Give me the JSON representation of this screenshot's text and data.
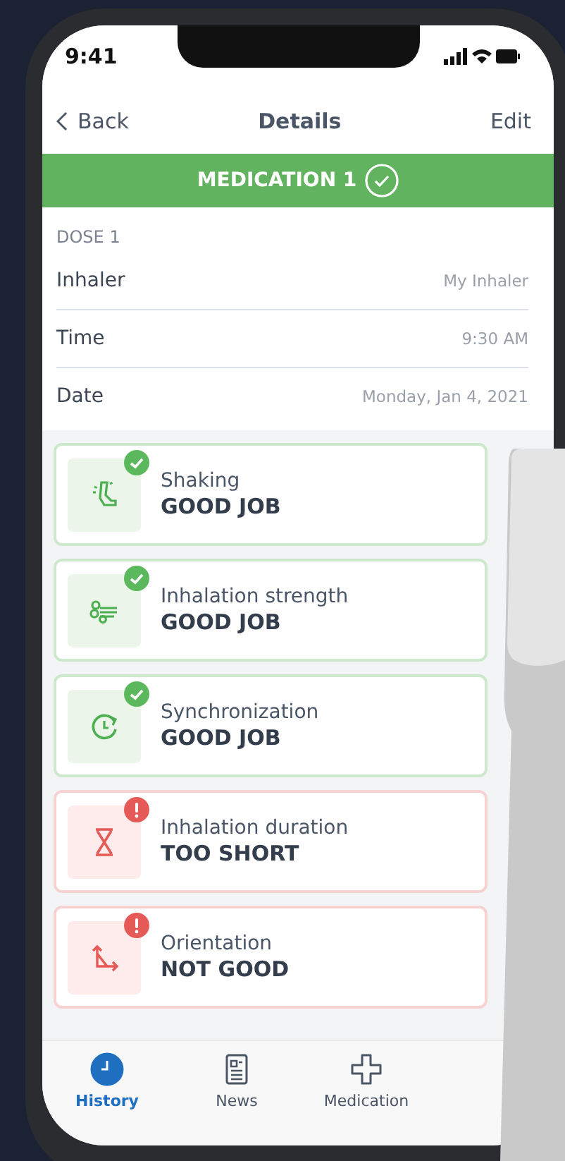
{
  "status_bar": {
    "time": "9:41"
  },
  "nav": {
    "back": "Back",
    "title": "Details",
    "action": "Edit"
  },
  "banner": {
    "label": "MEDICATION 1",
    "done": true
  },
  "dose": {
    "heading": "DOSE 1",
    "fields": [
      {
        "label": "Inhaler",
        "value": "My Inhaler"
      },
      {
        "label": "Time",
        "value": "9:30 AM"
      },
      {
        "label": "Date",
        "value": "Monday, Jan 4, 2021"
      }
    ]
  },
  "checks": [
    {
      "kind": "shaking",
      "title": "Shaking",
      "result": "GOOD JOB",
      "passed": true
    },
    {
      "kind": "strength",
      "title": "Inhalation strength",
      "result": "GOOD JOB",
      "passed": true
    },
    {
      "kind": "sync",
      "title": "Synchronization",
      "result": "GOOD JOB",
      "passed": true
    },
    {
      "kind": "duration",
      "title": "Inhalation duration",
      "result": "TOO SHORT",
      "passed": false
    },
    {
      "kind": "orientation",
      "title": "Orientation",
      "result": "NOT GOOD",
      "passed": false
    }
  ],
  "tabs": [
    {
      "kind": "history",
      "label": "History",
      "selected": true
    },
    {
      "kind": "news",
      "label": "News",
      "selected": false
    },
    {
      "kind": "medication",
      "label": "Medication",
      "selected": false
    }
  ]
}
